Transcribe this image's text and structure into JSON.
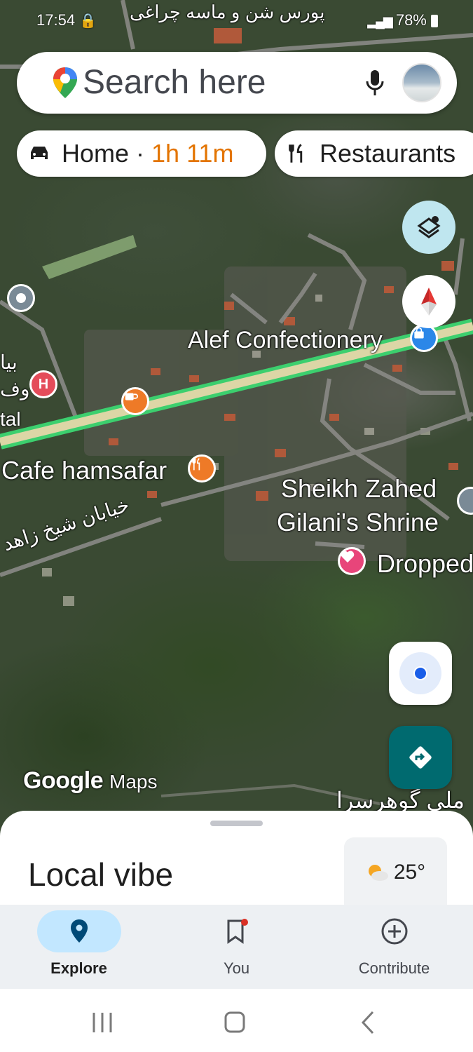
{
  "status_bar": {
    "time": "17:54",
    "battery": "78%"
  },
  "search": {
    "placeholder": "Search here"
  },
  "chips": [
    {
      "label": "Home",
      "separator": " · ",
      "duration": "1h 11m",
      "icon": "car-icon"
    },
    {
      "label": "Restaurants",
      "icon": "fork-knife-icon"
    }
  ],
  "map_labels": {
    "top_road": "پورس شن و ماسه چراغی",
    "alef": "Alef Confectionery",
    "cafe": "Cafe hamsafar",
    "shrine_line1": "Sheikh Zahed",
    "shrine_line2": "Gilani's Shrine",
    "dropped": "Dropped",
    "street": "خیابان شیخ زاهد",
    "bottom_right": "ملی گوهرسرا",
    "hospital_partial_1": "بیا",
    "hospital_partial_2": "وف",
    "hospital_partial_3": "tal"
  },
  "watermark": {
    "google": "Google",
    "maps": "Maps"
  },
  "sheet": {
    "title": "Local vibe",
    "temperature": "25°",
    "weather_icon": "partly-cloudy-icon"
  },
  "nav": [
    {
      "label": "Explore",
      "icon": "location-pin-icon",
      "active": true
    },
    {
      "label": "You",
      "icon": "bookmark-icon",
      "active": false
    },
    {
      "label": "Contribute",
      "icon": "add-circle-icon",
      "active": false
    }
  ],
  "colors": {
    "accent_teal": "#006a6f",
    "active_pill": "#c2e7ff",
    "duration_orange": "#e37400",
    "route_green": "#2fb56a"
  }
}
